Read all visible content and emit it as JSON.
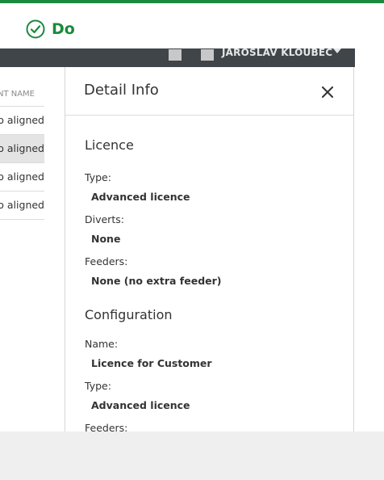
{
  "status": {
    "label": "Do",
    "color": "#1a8a3c",
    "icon": "check-circle-icon"
  },
  "appbar": {
    "user_name": "JAROSLAV KLOUBEC"
  },
  "list": {
    "column_header": "ALIGNMENT NAME",
    "rows": [
      "Mimo aligned",
      "Mimo aligned",
      "Mimo aligned",
      "Mimo aligned"
    ],
    "selected_index": 1
  },
  "detail": {
    "title": "Detail Info",
    "licence": {
      "title": "Licence",
      "type_label": "Type:",
      "type_value": "Advanced licence",
      "diverts_label": "Diverts:",
      "diverts_value": "None",
      "feeders_label": "Feeders:",
      "feeders_value": "None (no extra feeder)"
    },
    "configuration": {
      "title": "Configuration",
      "name_label": "Name:",
      "name_value": "Licence for Customer",
      "type_label": "Type:",
      "type_value": "Advanced licence",
      "feeders_label": "Feeders:"
    }
  }
}
